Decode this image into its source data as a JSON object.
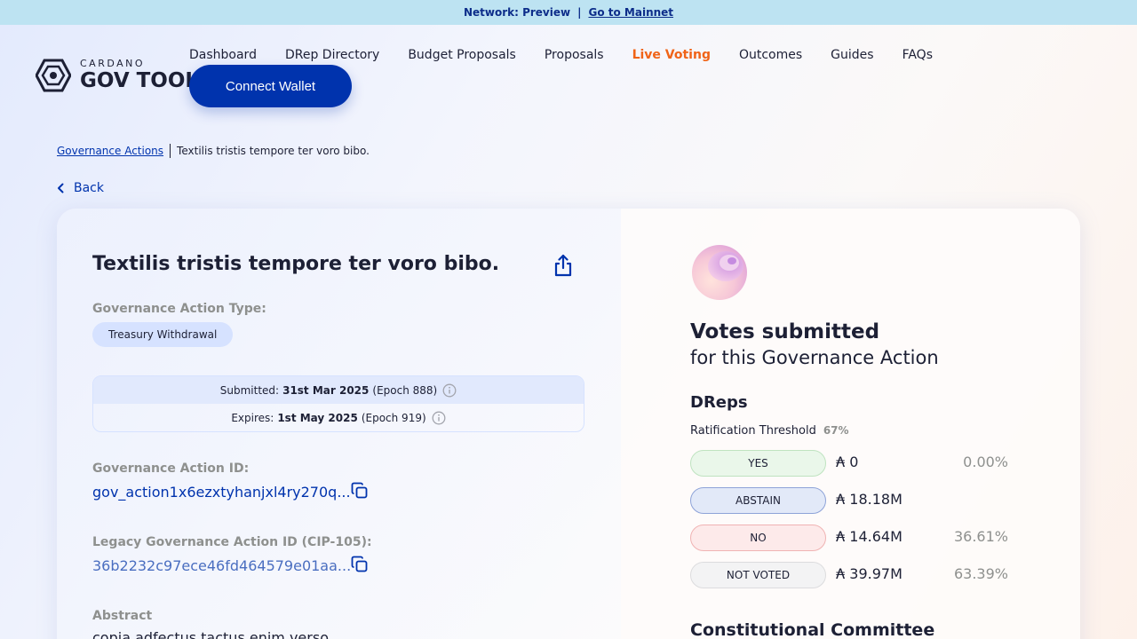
{
  "banner": {
    "network": "Network: Preview",
    "separator": "|",
    "link": "Go to Mainnet"
  },
  "logo": {
    "small": "CARDANO",
    "big": "GOV TOOL"
  },
  "nav": [
    {
      "label": "Dashboard",
      "active": false
    },
    {
      "label": "DRep Directory",
      "active": false
    },
    {
      "label": "Budget Proposals",
      "active": false
    },
    {
      "label": "Proposals",
      "active": false
    },
    {
      "label": "Live Voting",
      "active": true
    },
    {
      "label": "Outcomes",
      "active": false
    },
    {
      "label": "Guides",
      "active": false
    },
    {
      "label": "FAQs",
      "active": false
    }
  ],
  "connect_wallet": "Connect Wallet",
  "breadcrumb": {
    "parent": "Governance Actions",
    "current": "Textilis tristis tempore ter voro bibo."
  },
  "back": "Back",
  "action": {
    "title": "Textilis tristis tempore ter voro bibo.",
    "type_label": "Governance Action Type:",
    "type_value": "Treasury Withdrawal",
    "submitted": {
      "label": "Submitted:",
      "date": "31st Mar 2025",
      "epoch": "(Epoch 888)"
    },
    "expires": {
      "label": "Expires:",
      "date": "1st May 2025",
      "epoch": "(Epoch 919)"
    },
    "id_label": "Governance Action ID:",
    "id_value": "gov_action1x6ezxtyhanjxl4ry270q...",
    "legacy_label": "Legacy Governance Action ID (CIP-105):",
    "legacy_value": "36b2232c97ece46fd464579e01aa...",
    "abstract_label": "Abstract",
    "abstract_text": "copia adfectus tactus enim verso"
  },
  "votes": {
    "title": "Votes submitted",
    "subtitle": "for this Governance Action",
    "dreps_heading": "DReps",
    "threshold_label": "Ratification Threshold",
    "threshold_value": "67%",
    "rows": [
      {
        "label": "YES",
        "amount": "₳ 0",
        "percent": "0.00%"
      },
      {
        "label": "ABSTAIN",
        "amount": "₳ 18.18M",
        "percent": ""
      },
      {
        "label": "NO",
        "amount": "₳ 14.64M",
        "percent": "36.61%"
      },
      {
        "label": "NOT VOTED",
        "amount": "₳ 39.97M",
        "percent": "63.39%"
      }
    ],
    "cc_heading": "Constitutional Committee"
  },
  "colors": {
    "primary": "#0033ad",
    "active_nav": "#f06417",
    "yes_bg": "#eaf7ea",
    "yes_border": "#bfe3c0",
    "abstain_bg": "#e2e9f8",
    "abstain_border": "#8ea3d8",
    "no_bg": "#fdeaea",
    "no_border": "#f0b3b3",
    "notvoted_bg": "#f3f3f4",
    "notvoted_border": "#dcdcde"
  }
}
